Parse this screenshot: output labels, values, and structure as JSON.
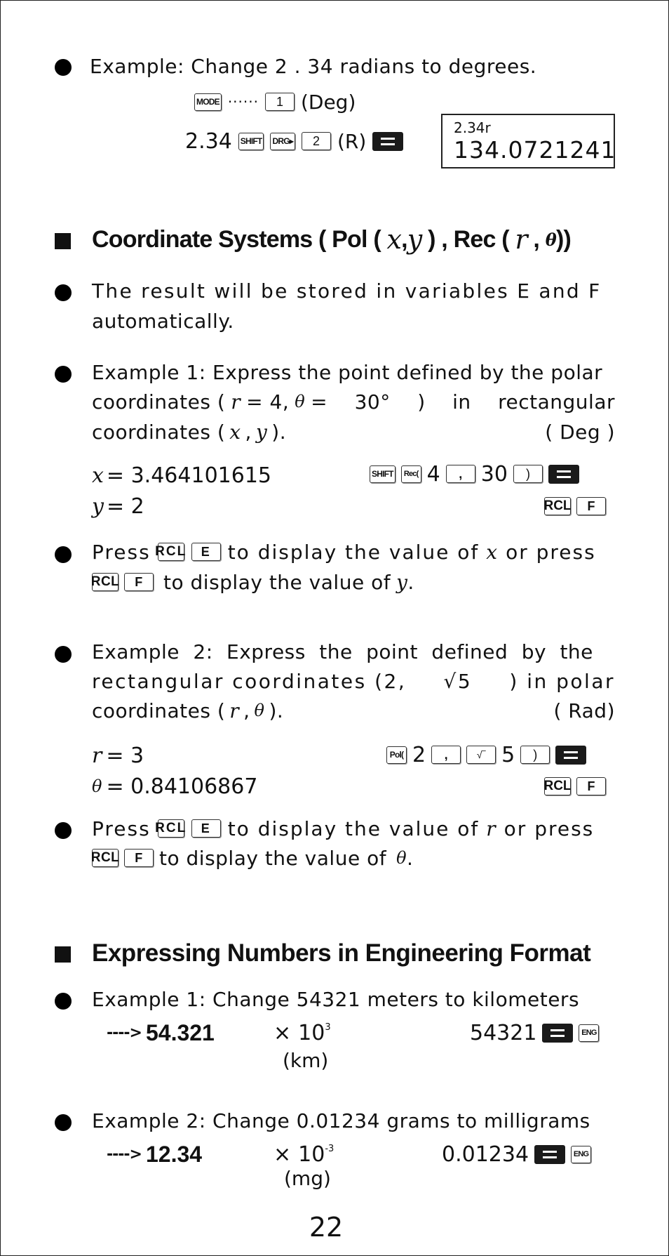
{
  "page_number": "22",
  "radians_example": {
    "text": "Example: Change 2 . 34 radians to degrees.",
    "mode_key": "MODE",
    "dots": "······",
    "key_1": "1",
    "deg_label": "(Deg)",
    "input_value": "2.34",
    "shift_key": "SHIFT",
    "drg_key": "DRG▸",
    "key_2": "2",
    "r_label": "(R)",
    "display_top": "2.34r",
    "display_result": "134.0721241"
  },
  "section_coordinates": {
    "heading_prefix": "Coordinate Systems ( Pol (",
    "heading_x": "x",
    "heading_comma1": ",",
    "heading_y": "y",
    "heading_mid": ") , Rec (",
    "heading_r": "r",
    "heading_comma2": ",",
    "heading_theta": "θ",
    "heading_suffix": "))",
    "note_line1": "The result will be stored in variables E and F",
    "note_line2": "automatically.",
    "example1": {
      "line1": "Example 1: Express the point defined by the polar",
      "line2_pre": "coordinates (",
      "line2_r": "r",
      "line2_mid": "= 4,",
      "line2_theta": "θ",
      "line2_post": "= 30° )  in  rectangular",
      "line3_pre": "coordinates (",
      "line3_x": "x",
      "line3_comma": ",",
      "line3_y": "y",
      "line3_post": ").",
      "mode_label": "( Deg )",
      "result_x_var": "x",
      "result_x_value": "= 3.464101615",
      "result_y_var": "y",
      "result_y_value": "= 2",
      "keys": {
        "shift": "SHIFT",
        "rec": "Rec(",
        "num_4": "4",
        "comma": ",",
        "num_30": "30",
        "close_paren": ")",
        "rcl": "RCL",
        "f": "F"
      }
    },
    "press1": {
      "press": "Press",
      "rcl": "RCL",
      "e": "E",
      "mid": "to display the value of",
      "var_x": "x",
      "or_press": "or press",
      "rcl2": "RCL",
      "f": "F",
      "end": "to display the value of",
      "var_y": "y",
      "period": "."
    },
    "example2": {
      "line1": "Example 2: Express the point defined by the",
      "line2_pre": "rectangular  coordinates  (2,",
      "line2_sqrt": "√5",
      "line2_post": ")  in  polar",
      "line3_pre": "coordinates (",
      "line3_r": "r",
      "line3_comma": ",",
      "line3_theta": "θ",
      "line3_post": ").",
      "mode_label": "( Rad)",
      "result_r_var": "r",
      "result_r_value": "= 3",
      "result_theta_var": "θ",
      "result_theta_value": "= 0.84106867",
      "keys": {
        "pol": "Pol(",
        "num_2": "2",
        "comma": ",",
        "sqrt": "√‾",
        "num_5": "5",
        "close_paren": ")",
        "rcl": "RCL",
        "f": "F"
      }
    },
    "press2": {
      "press": "Press",
      "rcl": "RCL",
      "e": "E",
      "mid": "to display the value of",
      "var_r": "r",
      "or_press": "or press",
      "rcl2": "RCL",
      "f": "F",
      "end": "to display the value of",
      "var_theta": "θ",
      "period": "."
    }
  },
  "section_engineering": {
    "heading": "Expressing Numbers in Engineering Format",
    "example1": {
      "text": "Example 1:  Change 54321 meters to kilometers",
      "arrow": "---->",
      "result": "54.321",
      "times": "×",
      "base": "10",
      "exponent": "3",
      "unit": "(km)",
      "input": "54321",
      "eng_key": "ENG"
    },
    "example2": {
      "text": "Example 2:  Change 0.01234 grams to milligrams",
      "arrow": "---->",
      "result": "12.34",
      "times": "×",
      "base": "10",
      "exponent": "-3",
      "unit": "(mg)",
      "input": "0.01234",
      "eng_key": "ENG"
    }
  }
}
